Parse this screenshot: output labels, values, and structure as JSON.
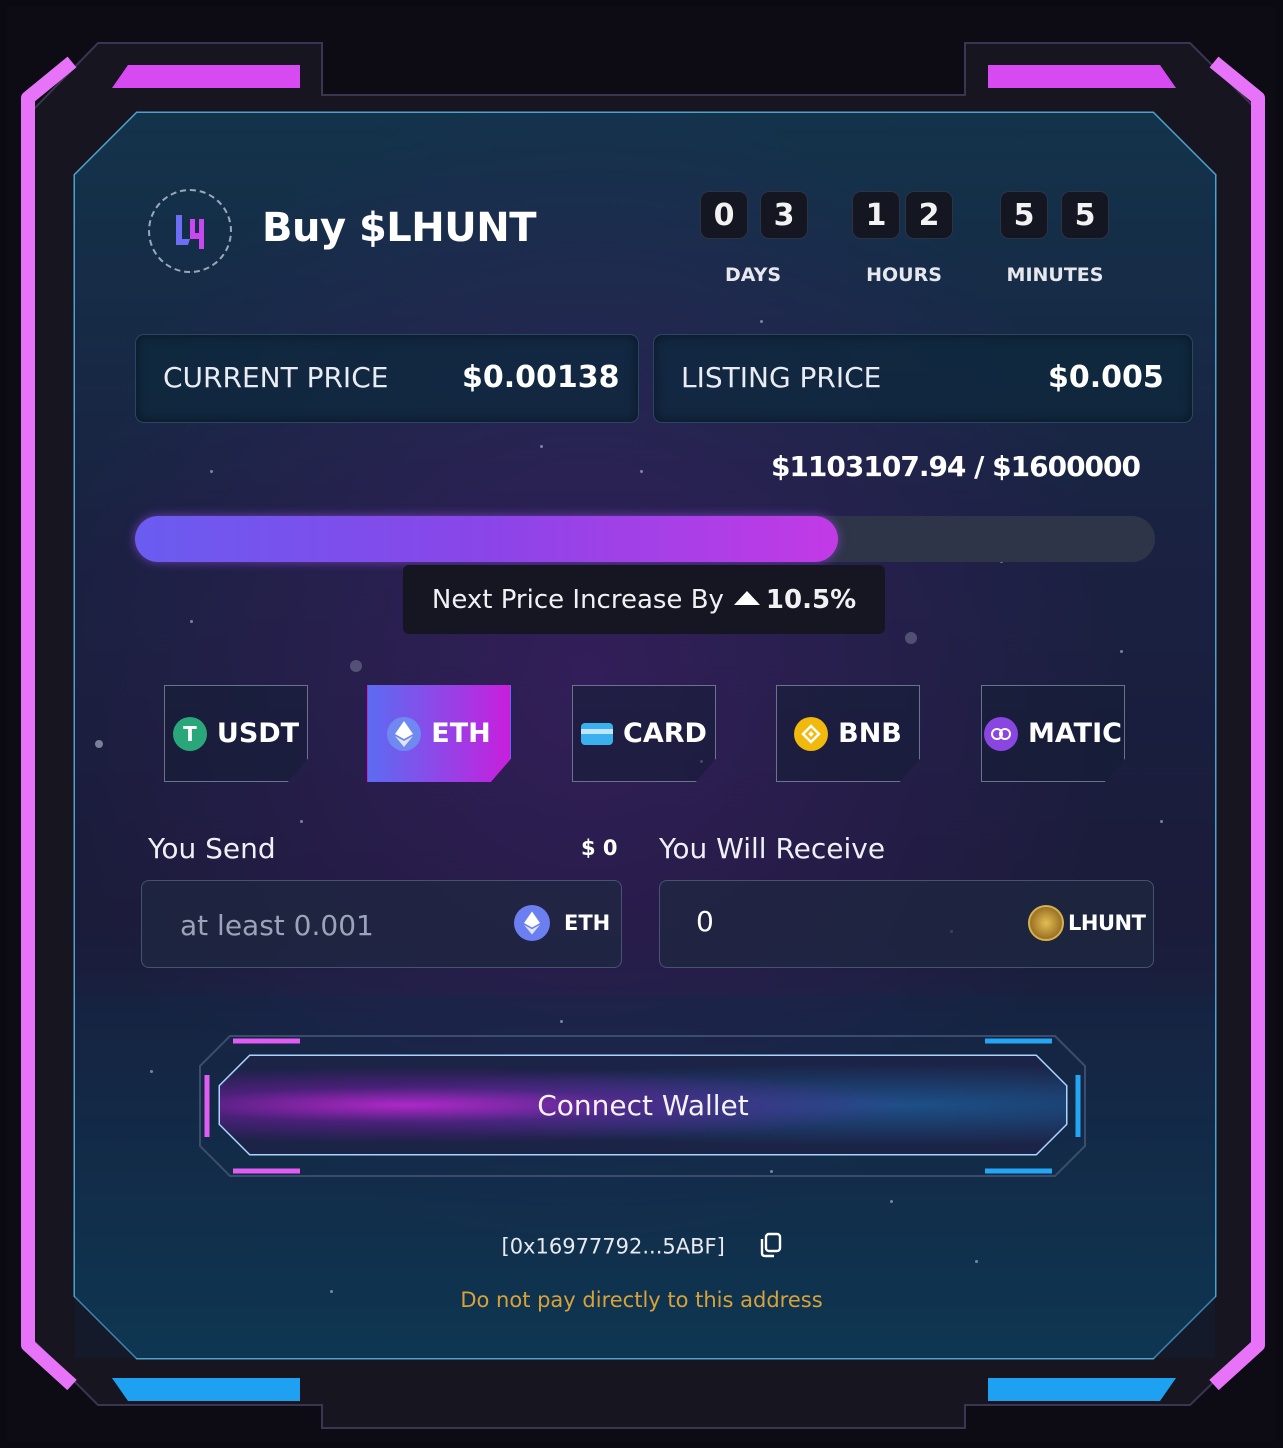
{
  "header": {
    "title": "Buy $LHUNT",
    "countdown": {
      "days": [
        "0",
        "3"
      ],
      "hours": [
        "1",
        "2"
      ],
      "minutes": [
        "5",
        "5"
      ],
      "days_label": "DAYS",
      "hours_label": "HOURS",
      "minutes_label": "MINUTES"
    }
  },
  "prices": {
    "current_label": "CURRENT PRICE",
    "current_value": "$0.00138",
    "listing_label": "LISTING PRICE",
    "listing_value": "$0.005"
  },
  "progress": {
    "raised_text": "$1103107.94 / $1600000",
    "raised": 1103107.94,
    "goal": 1600000
  },
  "next_increase": {
    "label": "Next Price Increase By",
    "value": "10.5%"
  },
  "currencies": [
    {
      "label": "USDT",
      "icon": "tether-icon",
      "color": "#2aa77a",
      "active": false
    },
    {
      "label": "ETH",
      "icon": "ethereum-icon",
      "color": "#6b7ff0",
      "active": true
    },
    {
      "label": "CARD",
      "icon": "credit-card-icon",
      "color": "#3ab0ee",
      "active": false
    },
    {
      "label": "BNB",
      "icon": "bnb-icon",
      "color": "#f0b90b",
      "active": false
    },
    {
      "label": "MATIC",
      "icon": "polygon-icon",
      "color": "#8a46e0",
      "active": false
    }
  ],
  "form": {
    "send_label": "You Send",
    "send_usd": "$ 0",
    "send_placeholder": "at least 0.001",
    "send_token": "ETH",
    "receive_label": "You Will Receive",
    "receive_value": "0",
    "receive_token": "LHUNT"
  },
  "connect_button": "Connect Wallet",
  "address": "[0x16977792...5ABF]",
  "warning": "Do not pay directly to this address",
  "colors": {
    "accent_pink": "#e15cf3",
    "accent_blue": "#25a6f5",
    "warning": "#d8a23a"
  }
}
